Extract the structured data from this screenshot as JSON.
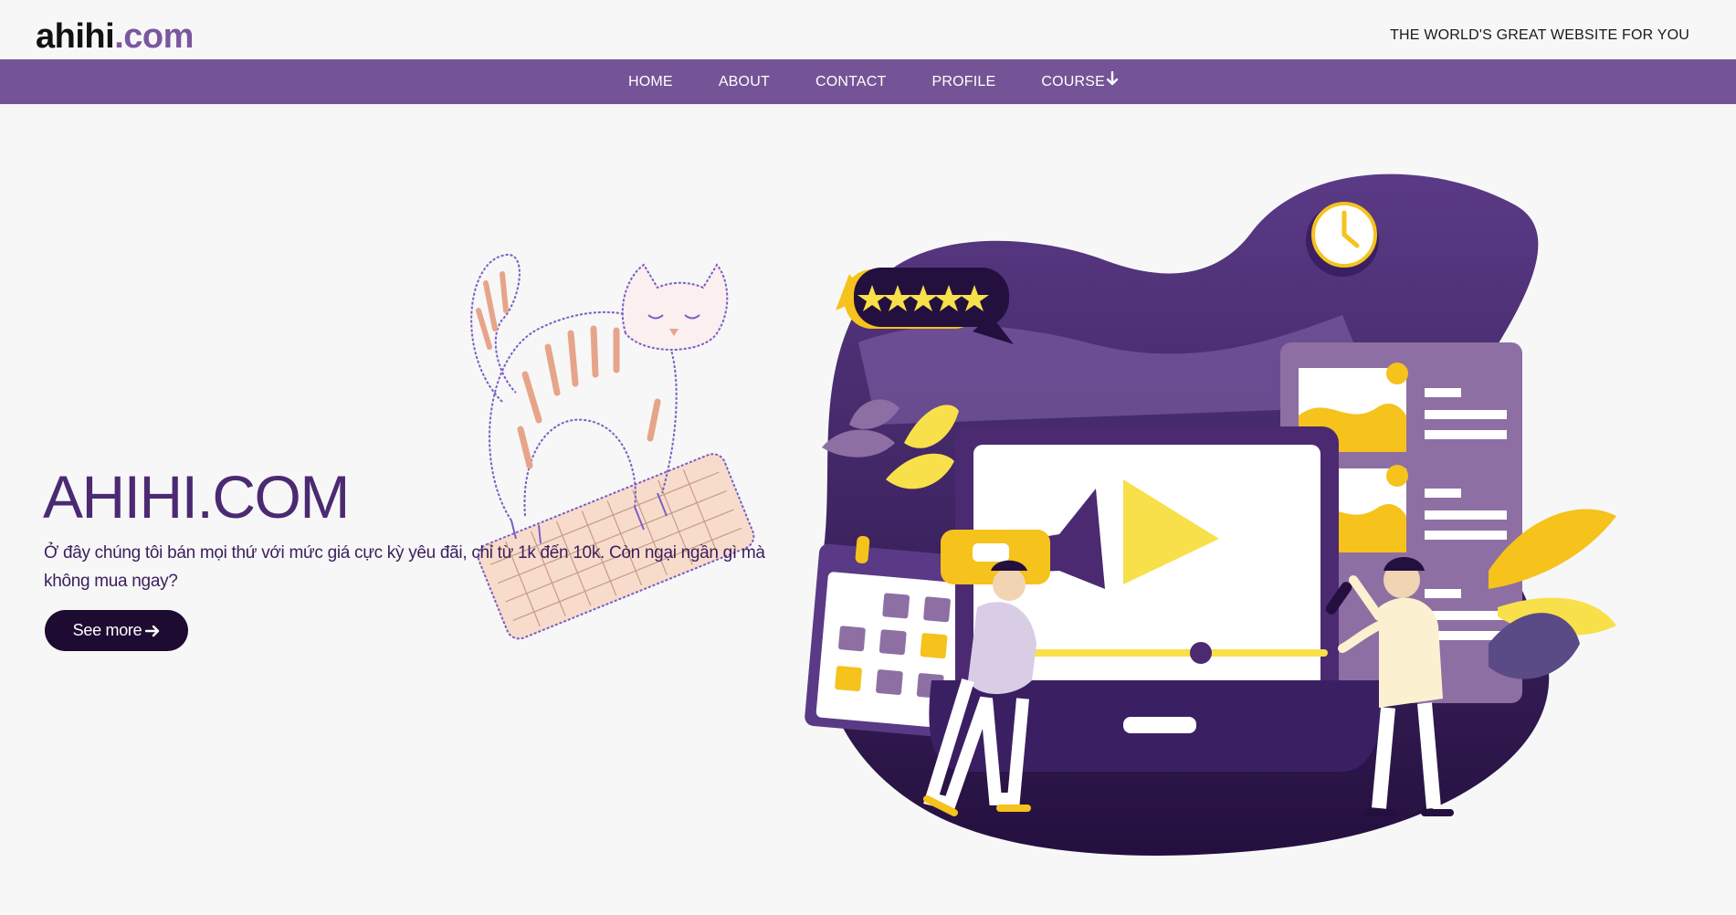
{
  "header": {
    "logo_main": "ahihi",
    "logo_suffix": ".com",
    "tagline": "THE WORLD'S GREAT WEBSITE FOR YOU"
  },
  "nav": {
    "items": [
      {
        "label": "HOME"
      },
      {
        "label": "ABOUT"
      },
      {
        "label": "CONTACT"
      },
      {
        "label": "PROFILE"
      },
      {
        "label": "COURSE",
        "icon": "arrow-down-icon"
      }
    ]
  },
  "hero": {
    "title": "AHIHI.COM",
    "description": "Ở đây chúng tôi bán mọi thứ với mức giá cực kỳ yêu đãi, chỉ từ 1k đến 10k. Còn ngại ngần gì mà không mua ngay?",
    "button_label": "See more",
    "button_icon": "arrow-right-icon"
  },
  "illustration": {
    "rating_stars": 5,
    "cat_sketch": "cat-on-keyboard-illustration",
    "marketing_scene": "video-marketing-illustration"
  },
  "colors": {
    "brand_purple": "#745496",
    "dark_purple": "#4b2a72",
    "button_dark": "#1d0b32",
    "accent_yellow": "#f6c21c",
    "background": "#f7f7f7"
  }
}
